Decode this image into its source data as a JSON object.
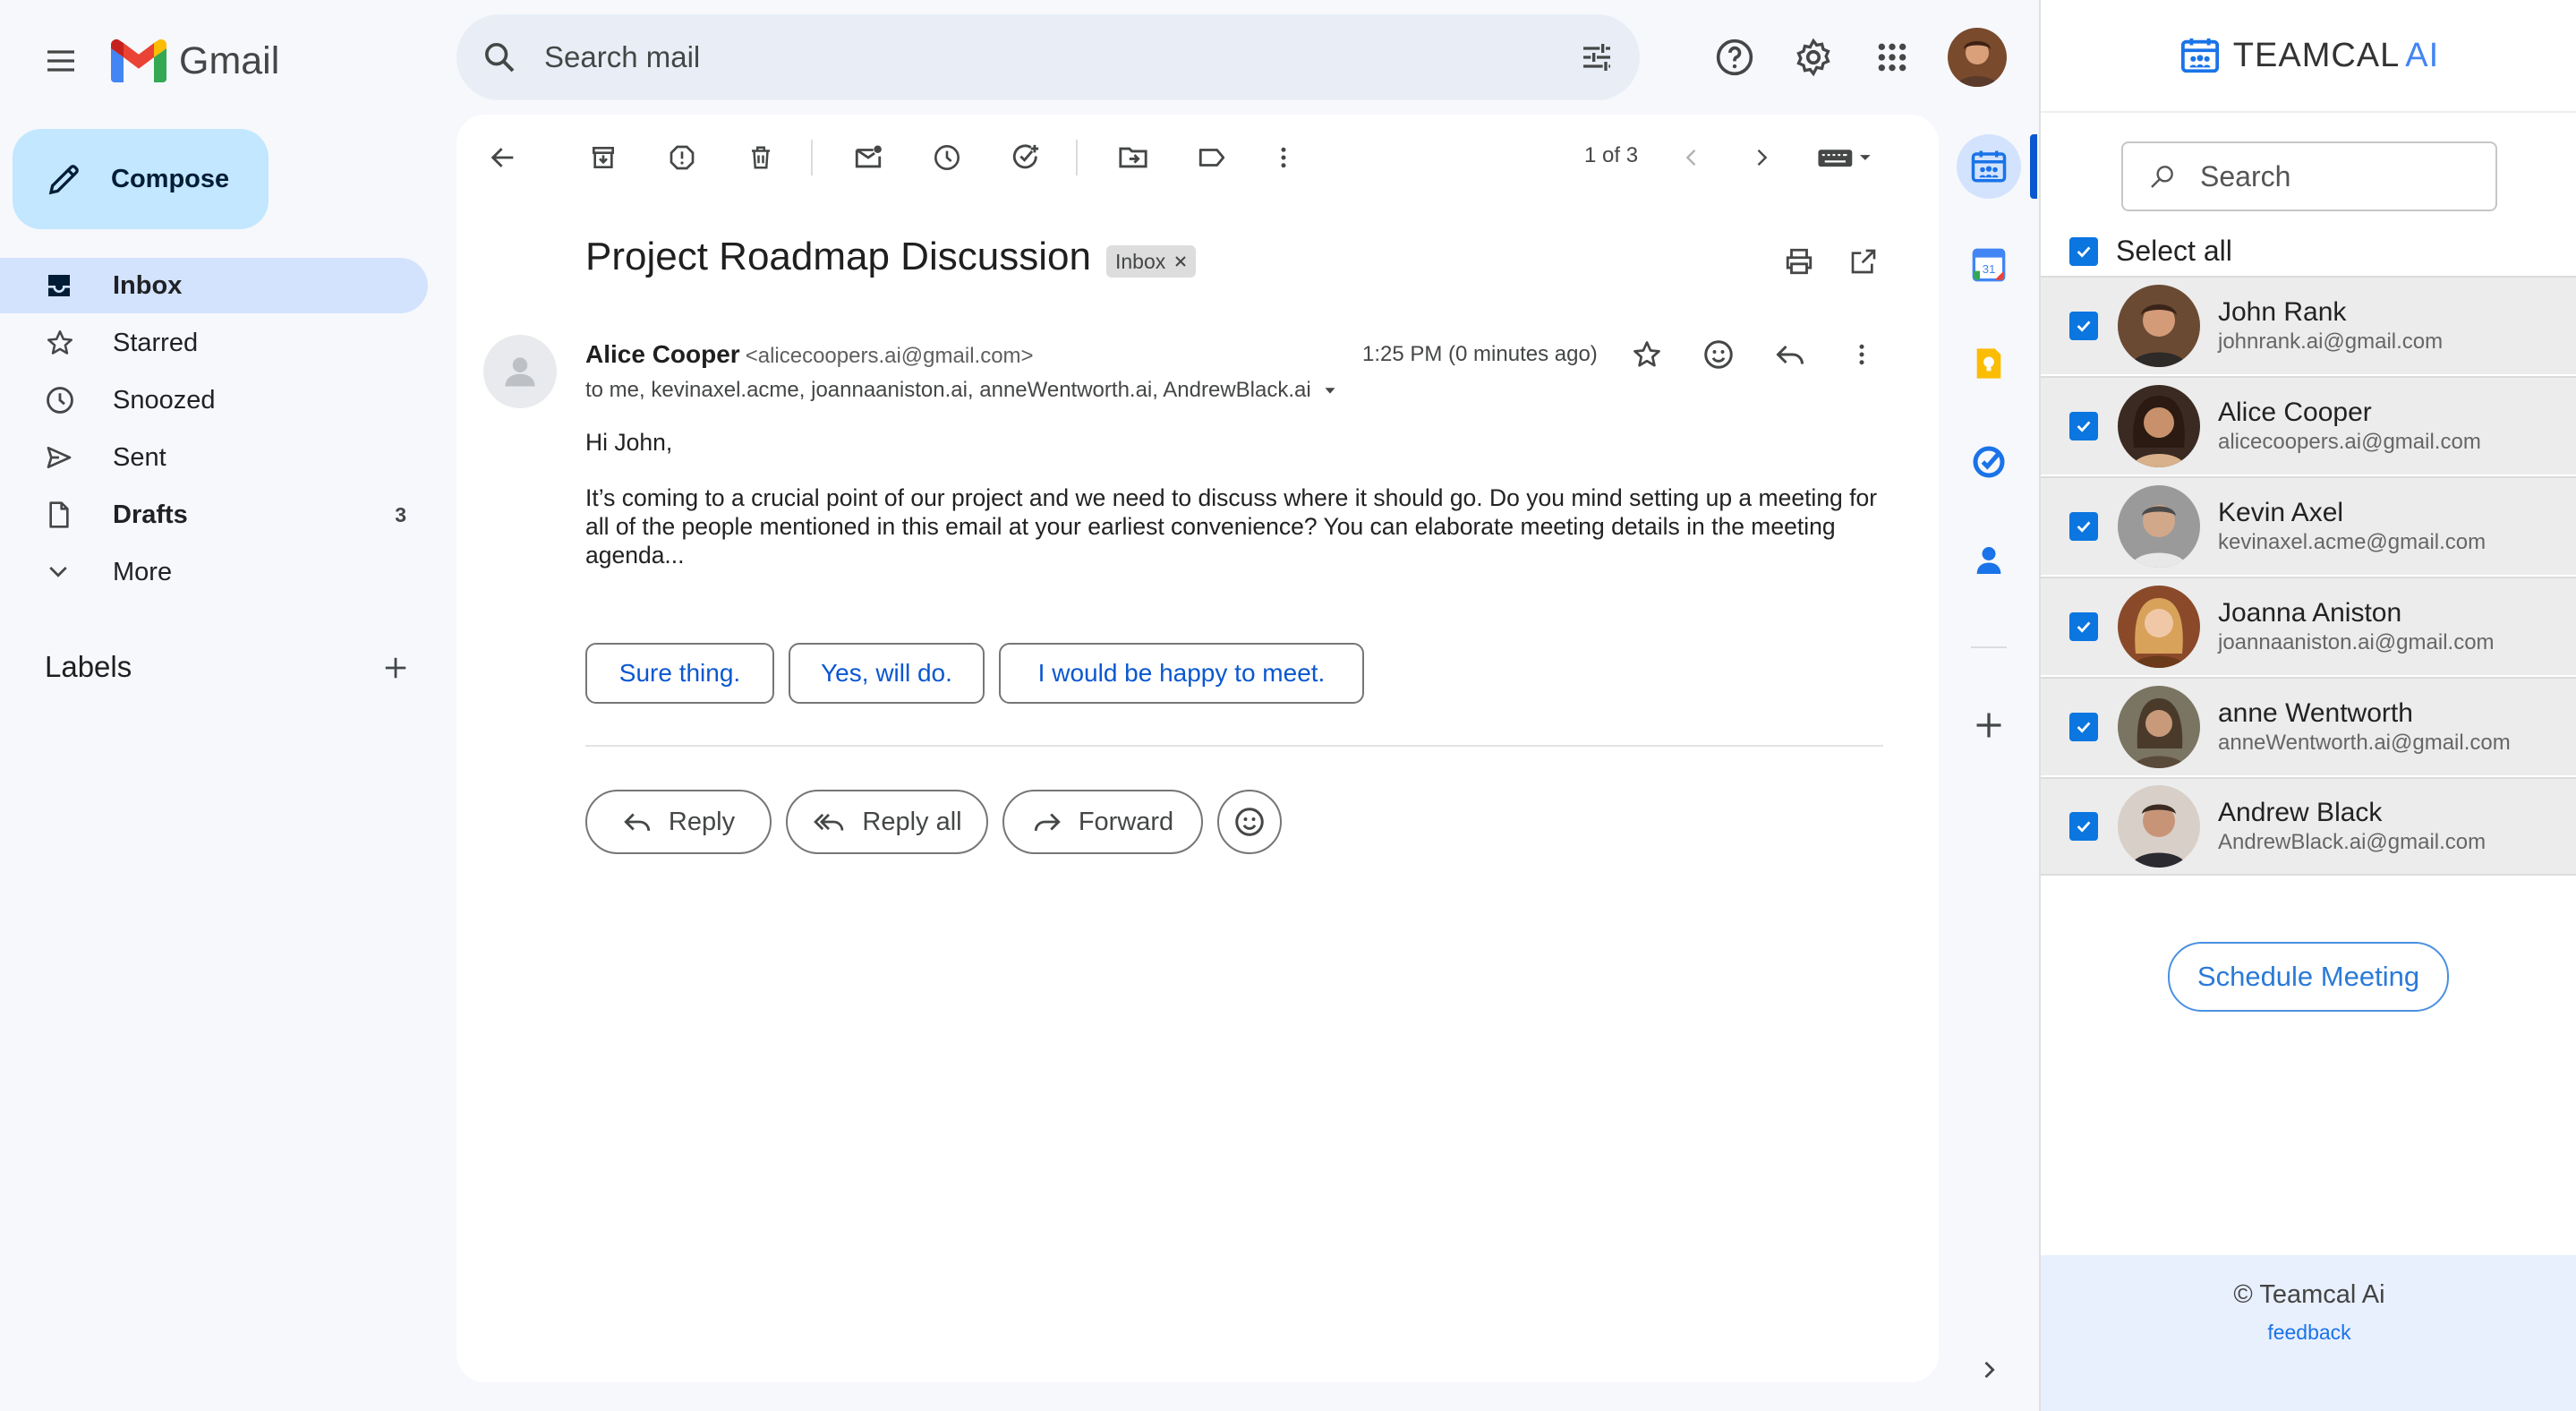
{
  "app": {
    "logo_text": "Gmail",
    "colors": {
      "accent": "#0b57d0",
      "compose_bg": "#c2e7ff",
      "active_nav": "#d3e3fd",
      "panel_accent": "#4285f4"
    }
  },
  "topbar": {
    "search_placeholder": "Search mail",
    "icons": [
      "menu-icon",
      "search-icon",
      "tune-icon",
      "help-icon",
      "settings-icon",
      "apps-icon",
      "avatar"
    ]
  },
  "sidebar": {
    "compose_label": "Compose",
    "items": [
      {
        "label": "Inbox",
        "icon": "inbox-icon",
        "count": ""
      },
      {
        "label": "Starred",
        "icon": "star-icon",
        "count": ""
      },
      {
        "label": "Snoozed",
        "icon": "clock-icon",
        "count": ""
      },
      {
        "label": "Sent",
        "icon": "send-icon",
        "count": ""
      },
      {
        "label": "Drafts",
        "icon": "draft-icon",
        "count": "3"
      },
      {
        "label": "More",
        "icon": "chevron-down-icon",
        "count": ""
      }
    ],
    "labels_heading": "Labels"
  },
  "toolbar": {
    "pager": "1 of 3"
  },
  "email": {
    "subject": "Project Roadmap Discussion",
    "chip": "Inbox",
    "sender_name": "Alice Cooper",
    "sender_email": "<alicecoopers.ai@gmail.com>",
    "recipients": "to me, kevinaxel.acme, joannaaniston.ai, anneWentworth.ai, AndrewBlack.ai",
    "time": "1:25 PM (0 minutes ago)",
    "greeting": "Hi John,",
    "body": "It’s coming to a crucial point of our project and we need to discuss where it should go. Do you mind setting up a meeting for all of the people mentioned in this email at your earliest convenience? You can elaborate meeting details in the meeting agenda...",
    "smart_replies": [
      "Sure thing.",
      "Yes, will do.",
      "I would be happy to meet."
    ],
    "actions": {
      "reply": "Reply",
      "reply_all": "Reply all",
      "forward": "Forward"
    }
  },
  "teamcal": {
    "title": "TEAMCAL",
    "title_ai": "AI",
    "search_placeholder": "Search",
    "select_all": "Select all",
    "contacts": [
      {
        "name": "John Rank",
        "email": "johnrank.ai@gmail.com"
      },
      {
        "name": "Alice Cooper",
        "email": "alicecoopers.ai@gmail.com"
      },
      {
        "name": "Kevin Axel",
        "email": "kevinaxel.acme@gmail.com"
      },
      {
        "name": "Joanna Aniston",
        "email": "joannaaniston.ai@gmail.com"
      },
      {
        "name": "anne Wentworth",
        "email": "anneWentworth.ai@gmail.com"
      },
      {
        "name": "Andrew Black",
        "email": "AndrewBlack.ai@gmail.com"
      }
    ],
    "schedule_button": "Schedule Meeting",
    "footer_copy": "© Teamcal Ai",
    "footer_link": "feedback"
  }
}
